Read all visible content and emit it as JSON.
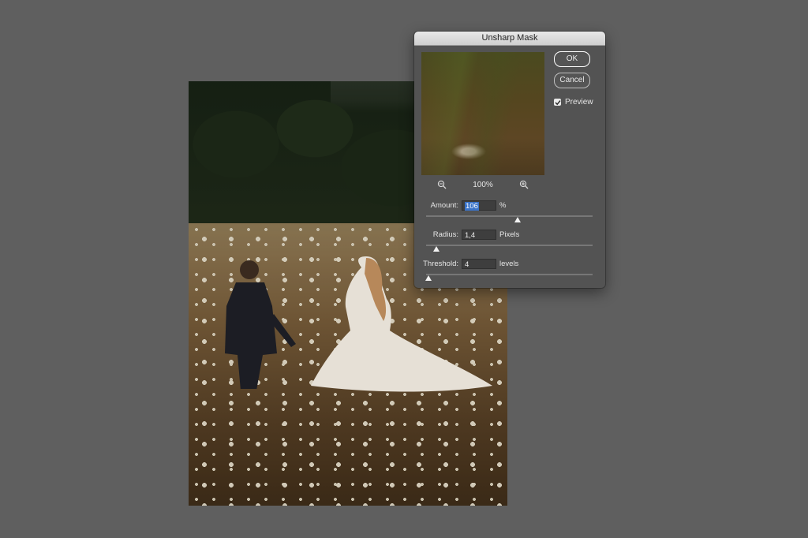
{
  "dialog": {
    "title": "Unsharp Mask",
    "ok_label": "OK",
    "cancel_label": "Cancel",
    "preview_label": "Preview",
    "preview_checked": true,
    "zoom_value": "100%",
    "zoom_out_icon": "zoom-out-icon",
    "zoom_in_icon": "zoom-in-icon"
  },
  "params": {
    "amount": {
      "label": "Amount:",
      "value": "106",
      "unit": "%",
      "slider_level": 0.55
    },
    "radius": {
      "label": "Radius:",
      "value": "1,4",
      "unit": "Pixels",
      "slider_level": 0.06
    },
    "threshold": {
      "label": "Threshold:",
      "value": "4",
      "unit": "levels",
      "slider_level": 0.015
    }
  },
  "colors": {
    "background": "#5f5f5f",
    "dialog": "#535353",
    "selection": "#3a73c8"
  }
}
